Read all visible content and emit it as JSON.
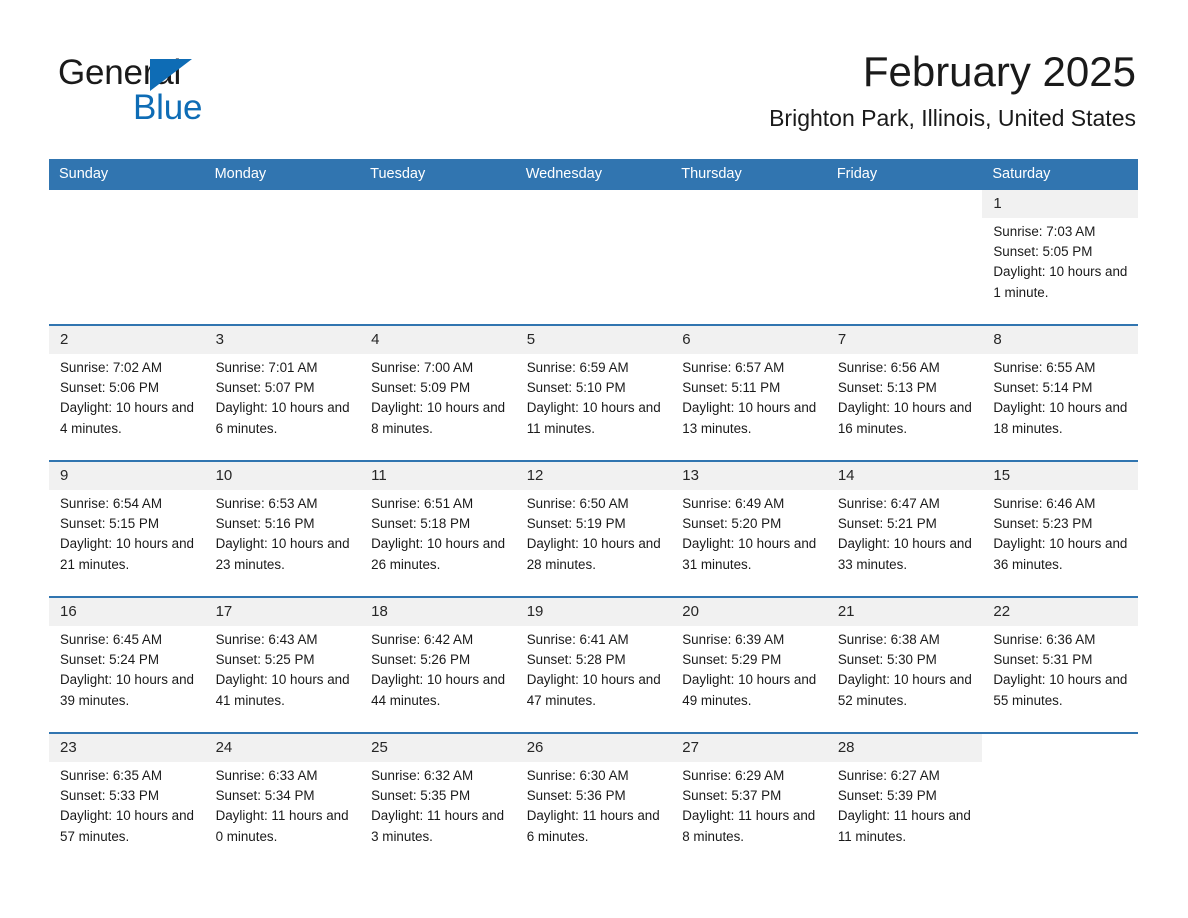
{
  "brand": {
    "name_part1": "General",
    "name_part2": "Blue",
    "triangle_color": "#0e6cb5"
  },
  "header": {
    "month_title": "February 2025",
    "location": "Brighton Park, Illinois, United States"
  },
  "theme": {
    "header_blue": "#3175b0",
    "daynum_band": "#f1f1f1",
    "row_rule": "#3175b0",
    "text": "#1a1a1a"
  },
  "weekday_headers": [
    "Sunday",
    "Monday",
    "Tuesday",
    "Wednesday",
    "Thursday",
    "Friday",
    "Saturday"
  ],
  "weeks": [
    [
      {
        "day": "",
        "empty": true
      },
      {
        "day": "",
        "empty": true
      },
      {
        "day": "",
        "empty": true
      },
      {
        "day": "",
        "empty": true
      },
      {
        "day": "",
        "empty": true
      },
      {
        "day": "",
        "empty": true
      },
      {
        "day": "1",
        "sunrise": "Sunrise: 7:03 AM",
        "sunset": "Sunset: 5:05 PM",
        "daylight": "Daylight: 10 hours and 1 minute."
      }
    ],
    [
      {
        "day": "2",
        "sunrise": "Sunrise: 7:02 AM",
        "sunset": "Sunset: 5:06 PM",
        "daylight": "Daylight: 10 hours and 4 minutes."
      },
      {
        "day": "3",
        "sunrise": "Sunrise: 7:01 AM",
        "sunset": "Sunset: 5:07 PM",
        "daylight": "Daylight: 10 hours and 6 minutes."
      },
      {
        "day": "4",
        "sunrise": "Sunrise: 7:00 AM",
        "sunset": "Sunset: 5:09 PM",
        "daylight": "Daylight: 10 hours and 8 minutes."
      },
      {
        "day": "5",
        "sunrise": "Sunrise: 6:59 AM",
        "sunset": "Sunset: 5:10 PM",
        "daylight": "Daylight: 10 hours and 11 minutes."
      },
      {
        "day": "6",
        "sunrise": "Sunrise: 6:57 AM",
        "sunset": "Sunset: 5:11 PM",
        "daylight": "Daylight: 10 hours and 13 minutes."
      },
      {
        "day": "7",
        "sunrise": "Sunrise: 6:56 AM",
        "sunset": "Sunset: 5:13 PM",
        "daylight": "Daylight: 10 hours and 16 minutes."
      },
      {
        "day": "8",
        "sunrise": "Sunrise: 6:55 AM",
        "sunset": "Sunset: 5:14 PM",
        "daylight": "Daylight: 10 hours and 18 minutes."
      }
    ],
    [
      {
        "day": "9",
        "sunrise": "Sunrise: 6:54 AM",
        "sunset": "Sunset: 5:15 PM",
        "daylight": "Daylight: 10 hours and 21 minutes."
      },
      {
        "day": "10",
        "sunrise": "Sunrise: 6:53 AM",
        "sunset": "Sunset: 5:16 PM",
        "daylight": "Daylight: 10 hours and 23 minutes."
      },
      {
        "day": "11",
        "sunrise": "Sunrise: 6:51 AM",
        "sunset": "Sunset: 5:18 PM",
        "daylight": "Daylight: 10 hours and 26 minutes."
      },
      {
        "day": "12",
        "sunrise": "Sunrise: 6:50 AM",
        "sunset": "Sunset: 5:19 PM",
        "daylight": "Daylight: 10 hours and 28 minutes."
      },
      {
        "day": "13",
        "sunrise": "Sunrise: 6:49 AM",
        "sunset": "Sunset: 5:20 PM",
        "daylight": "Daylight: 10 hours and 31 minutes."
      },
      {
        "day": "14",
        "sunrise": "Sunrise: 6:47 AM",
        "sunset": "Sunset: 5:21 PM",
        "daylight": "Daylight: 10 hours and 33 minutes."
      },
      {
        "day": "15",
        "sunrise": "Sunrise: 6:46 AM",
        "sunset": "Sunset: 5:23 PM",
        "daylight": "Daylight: 10 hours and 36 minutes."
      }
    ],
    [
      {
        "day": "16",
        "sunrise": "Sunrise: 6:45 AM",
        "sunset": "Sunset: 5:24 PM",
        "daylight": "Daylight: 10 hours and 39 minutes."
      },
      {
        "day": "17",
        "sunrise": "Sunrise: 6:43 AM",
        "sunset": "Sunset: 5:25 PM",
        "daylight": "Daylight: 10 hours and 41 minutes."
      },
      {
        "day": "18",
        "sunrise": "Sunrise: 6:42 AM",
        "sunset": "Sunset: 5:26 PM",
        "daylight": "Daylight: 10 hours and 44 minutes."
      },
      {
        "day": "19",
        "sunrise": "Sunrise: 6:41 AM",
        "sunset": "Sunset: 5:28 PM",
        "daylight": "Daylight: 10 hours and 47 minutes."
      },
      {
        "day": "20",
        "sunrise": "Sunrise: 6:39 AM",
        "sunset": "Sunset: 5:29 PM",
        "daylight": "Daylight: 10 hours and 49 minutes."
      },
      {
        "day": "21",
        "sunrise": "Sunrise: 6:38 AM",
        "sunset": "Sunset: 5:30 PM",
        "daylight": "Daylight: 10 hours and 52 minutes."
      },
      {
        "day": "22",
        "sunrise": "Sunrise: 6:36 AM",
        "sunset": "Sunset: 5:31 PM",
        "daylight": "Daylight: 10 hours and 55 minutes."
      }
    ],
    [
      {
        "day": "23",
        "sunrise": "Sunrise: 6:35 AM",
        "sunset": "Sunset: 5:33 PM",
        "daylight": "Daylight: 10 hours and 57 minutes."
      },
      {
        "day": "24",
        "sunrise": "Sunrise: 6:33 AM",
        "sunset": "Sunset: 5:34 PM",
        "daylight": "Daylight: 11 hours and 0 minutes."
      },
      {
        "day": "25",
        "sunrise": "Sunrise: 6:32 AM",
        "sunset": "Sunset: 5:35 PM",
        "daylight": "Daylight: 11 hours and 3 minutes."
      },
      {
        "day": "26",
        "sunrise": "Sunrise: 6:30 AM",
        "sunset": "Sunset: 5:36 PM",
        "daylight": "Daylight: 11 hours and 6 minutes."
      },
      {
        "day": "27",
        "sunrise": "Sunrise: 6:29 AM",
        "sunset": "Sunset: 5:37 PM",
        "daylight": "Daylight: 11 hours and 8 minutes."
      },
      {
        "day": "28",
        "sunrise": "Sunrise: 6:27 AM",
        "sunset": "Sunset: 5:39 PM",
        "daylight": "Daylight: 11 hours and 11 minutes."
      },
      {
        "day": "",
        "empty": true
      }
    ]
  ]
}
